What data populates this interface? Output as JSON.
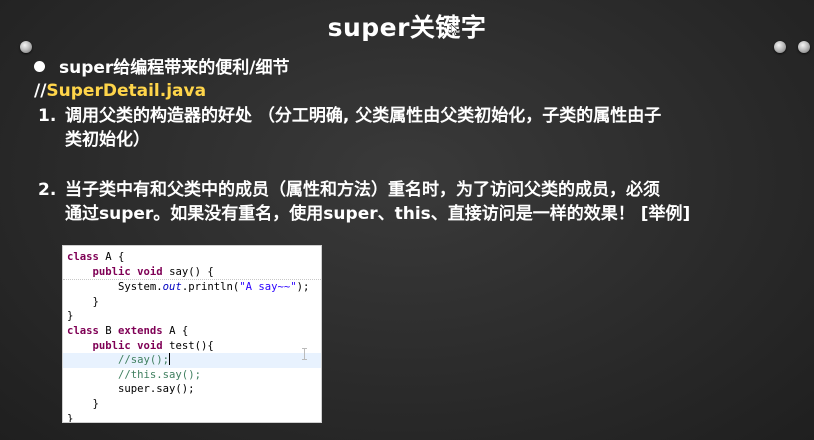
{
  "slide": {
    "title": "super关键字",
    "bullet": "super给编程带来的便利/细节",
    "file_prefix": "//",
    "file_name": "SuperDetail.java",
    "colors": {
      "accent": "#ffd54a",
      "text": "#ffffff",
      "background": "#2b2b2b"
    },
    "points": [
      {
        "number": "1.",
        "lines": [
          "调用父类的构造器的好处 （分工明确, 父类属性由父类初始化，子类的属性由子",
          "类初始化）"
        ]
      },
      {
        "number": "2.",
        "lines": [
          "当子类中有和父类中的成员（属性和方法）重名时，为了访问父类的成员，必须",
          "通过super。如果没有重名，使用super、this、直接访问是一样的效果！ [举例]"
        ]
      }
    ]
  },
  "code": {
    "l1_kw": "class",
    "l1_rest": " A {",
    "l2_indent": "    ",
    "l2_kw": "public void",
    "l2_rest": " say() {",
    "l3_pre": "        System.",
    "l3_out": "out",
    "l3_mid": ".println(",
    "l3_str": "\"A say~~\"",
    "l3_end": ");",
    "l4": "    }",
    "l5": "}",
    "l6_kw1": "class",
    "l6_mid": " B ",
    "l6_kw2": "extends",
    "l6_rest": " A {",
    "l7_indent": "    ",
    "l7_kw": "public void",
    "l7_rest": " test(){",
    "l8_indent": "        ",
    "l8_cmt": "//say();",
    "l9_indent": "        ",
    "l9_cmt": "//this.say();",
    "l10": "        super.say();",
    "l11": "    }",
    "l12": "}"
  }
}
